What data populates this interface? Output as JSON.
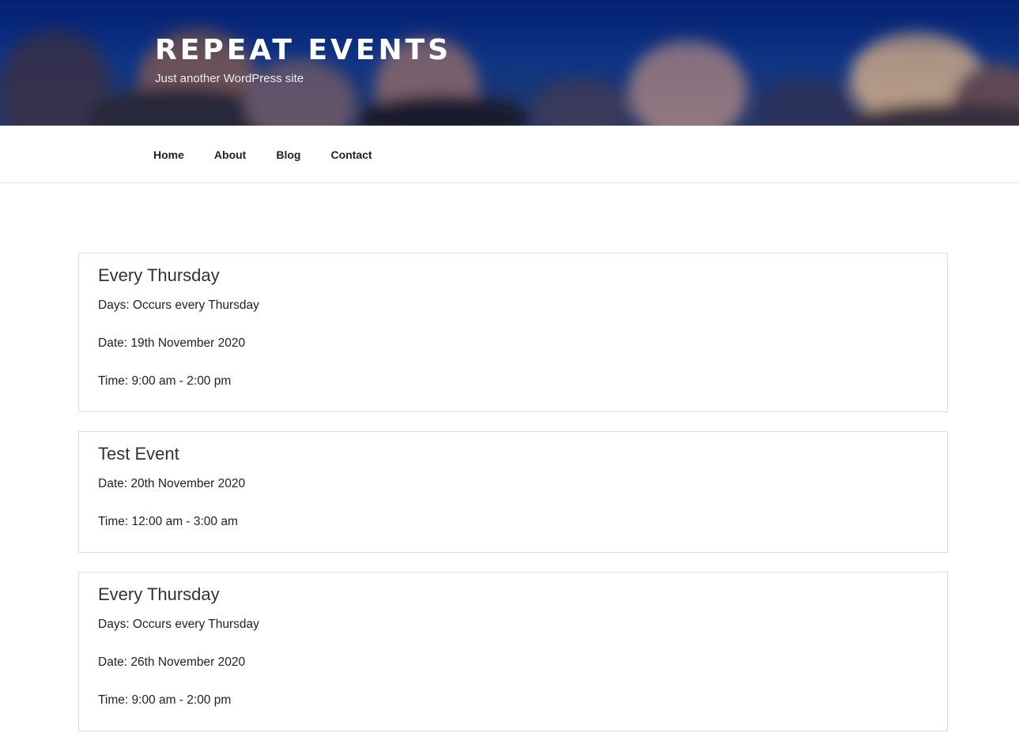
{
  "site": {
    "title": "REPEAT EVENTS",
    "tagline": "Just another WordPress site",
    "header_color": "#0d2f86"
  },
  "nav": {
    "items": [
      {
        "label": "Home"
      },
      {
        "label": "About"
      },
      {
        "label": "Blog"
      },
      {
        "label": "Contact"
      }
    ]
  },
  "events": [
    {
      "title": "Every Thursday",
      "days": "Days: Occurs every Thursday",
      "date": "Date: 19th November 2020",
      "time": "Time: 9:00 am - 2:00 pm"
    },
    {
      "title": "Test Event",
      "date": "Date: 20th November 2020",
      "time": "Time: 12:00 am - 3:00 am"
    },
    {
      "title": "Every Thursday",
      "days": "Days: Occurs every Thursday",
      "date": "Date: 26th November 2020",
      "time": "Time: 9:00 am - 2:00 pm"
    }
  ]
}
